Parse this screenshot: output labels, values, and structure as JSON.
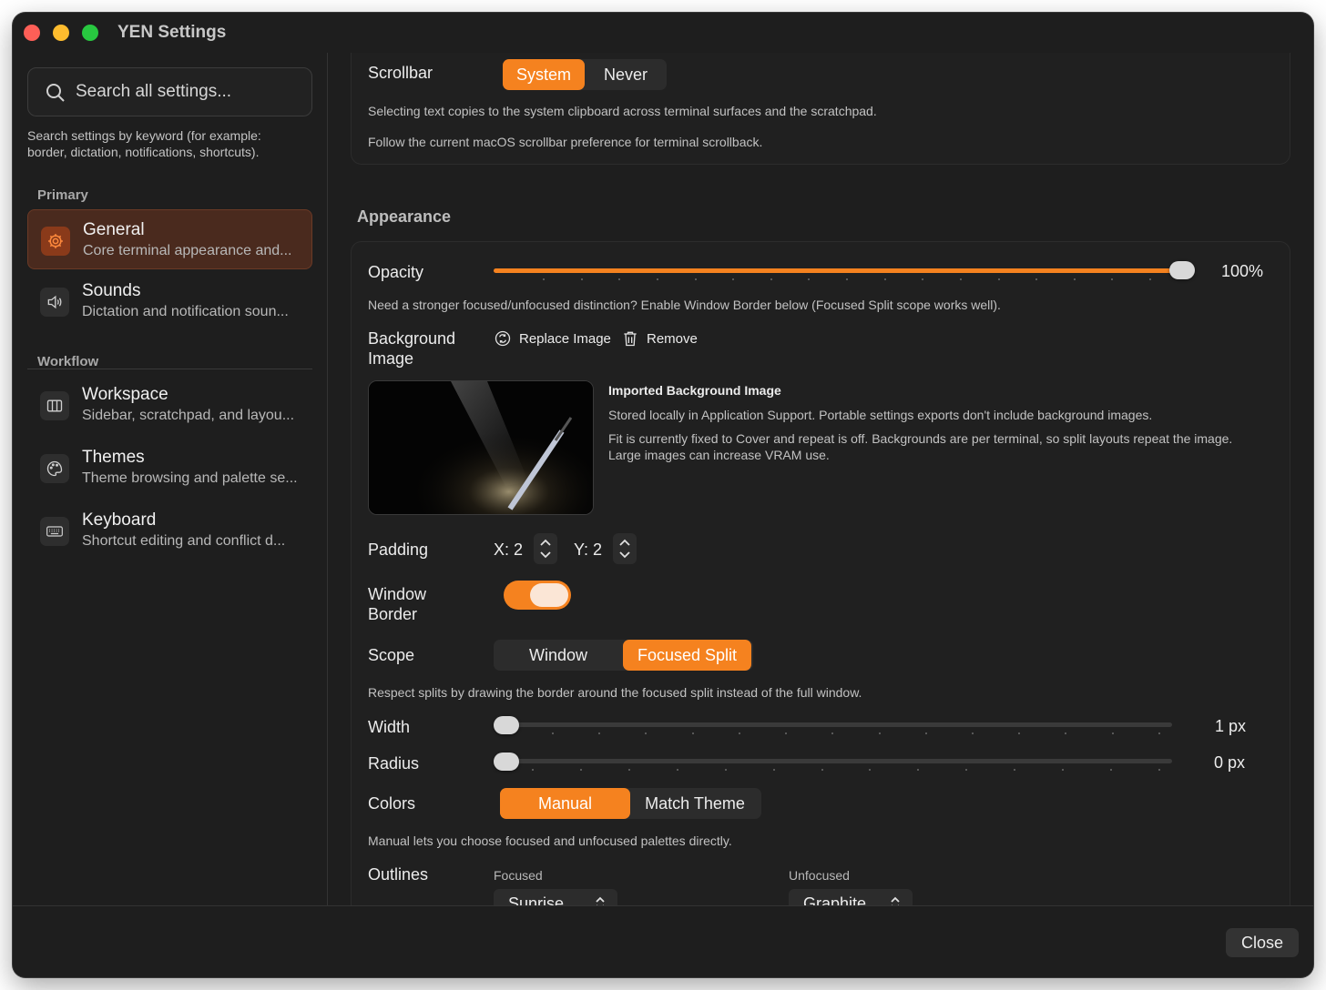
{
  "window": {
    "title": "YEN Settings"
  },
  "search": {
    "placeholder": "Search all settings...",
    "help": "Search settings by keyword (for example: border, dictation, notifications, shortcuts)."
  },
  "sidebar": {
    "primary_label": "Primary",
    "workflow_label": "Workflow",
    "items": [
      {
        "title": "General",
        "subtitle": "Core terminal appearance and...",
        "icon": "gear-icon",
        "active": true
      },
      {
        "title": "Sounds",
        "subtitle": "Dictation and notification soun...",
        "icon": "speaker-icon",
        "active": false
      },
      {
        "title": "Workspace",
        "subtitle": "Sidebar, scratchpad, and layou...",
        "icon": "columns-icon",
        "active": false
      },
      {
        "title": "Themes",
        "subtitle": "Theme browsing and palette se...",
        "icon": "palette-icon",
        "active": false
      },
      {
        "title": "Keyboard",
        "subtitle": "Shortcut editing and conflict d...",
        "icon": "keyboard-icon",
        "active": false
      }
    ]
  },
  "scrollbar": {
    "label": "Scrollbar",
    "options": [
      "System",
      "Never"
    ],
    "selected": "System",
    "help_1": "Selecting text copies to the system clipboard across terminal surfaces and the scratchpad.",
    "help_2": "Follow the current macOS scrollbar preference for terminal scrollback."
  },
  "appearance": {
    "section_title": "Appearance",
    "opacity": {
      "label": "Opacity",
      "value": 1.0,
      "value_text": "100%"
    },
    "opacity_help": "Need a stronger focused/unfocused distinction? Enable Window Border below (Focused Split scope works well).",
    "background_image": {
      "label": "Background Image",
      "replace_label": "Replace Image",
      "remove_label": "Remove",
      "title": "Imported Background Image",
      "desc_1": "Stored locally in Application Support. Portable settings exports don't include background images.",
      "desc_2": "Fit is currently fixed to Cover and repeat is off. Backgrounds are per terminal, so split layouts repeat the image. Large images can increase VRAM use."
    },
    "padding": {
      "label": "Padding",
      "x_text": "X: 2",
      "y_text": "Y: 2"
    },
    "window_border": {
      "label": "Window Border",
      "enabled": true
    },
    "scope": {
      "label": "Scope",
      "options": [
        "Window",
        "Focused Split"
      ],
      "selected": "Focused Split",
      "help": "Respect splits by drawing the border around the focused split instead of the full window."
    },
    "width": {
      "label": "Width",
      "value_text": "1 px",
      "value": 0
    },
    "radius": {
      "label": "Radius",
      "value_text": "0 px",
      "value": 0
    },
    "colors": {
      "label": "Colors",
      "options": [
        "Manual",
        "Match Theme"
      ],
      "selected": "Manual",
      "help": "Manual lets you choose focused and unfocused palettes directly."
    },
    "outlines": {
      "label": "Outlines",
      "focused_label": "Focused",
      "focused_value": "Sunrise",
      "unfocused_label": "Unfocused",
      "unfocused_value": "Graphite"
    }
  },
  "footer": {
    "close_label": "Close"
  },
  "colors": {
    "accent": "#f5821f",
    "window_bg": "#1e1e1e",
    "active_nav_bg": "#4a2a1e"
  }
}
